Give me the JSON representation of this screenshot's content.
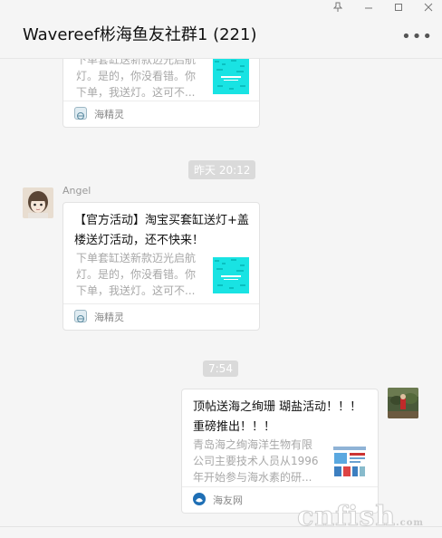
{
  "window": {
    "title": "Wavereef彬海鱼友社群1 (221)",
    "controls": [
      "pin",
      "minimize",
      "maximize",
      "close"
    ],
    "more_label": "•••"
  },
  "messages": [
    {
      "type": "card",
      "partial": true,
      "desc": "下单套缸送新款迈光启航灯。是的，你没看错。你下单，我送灯。这可不...",
      "source": "海精灵"
    },
    {
      "type": "time",
      "text": "昨天 20:12"
    },
    {
      "type": "card",
      "sender": "Angel",
      "title": "【官方活动】淘宝买套缸送灯+盖楼送灯活动，还不快来！",
      "desc": "下单套缸送新款迈光启航灯。是的，你没看错。你下单，我送灯。这可不...",
      "source": "海精灵"
    },
    {
      "type": "time",
      "text": "7:54"
    },
    {
      "type": "card",
      "self": true,
      "title": "顶帖送海之绚珊 瑚盐活动！！！重磅推出！！！",
      "desc": "青岛海之绚海洋生物有限公司主要技术人员从1996年开始参与海水素的研...",
      "source": "海友网"
    }
  ],
  "watermark": "cnfish",
  "watermark_suffix": ".com",
  "colors": {
    "background": "#f5f5f5",
    "card": "#ffffff",
    "time_pill": "#dadada",
    "thumb_cyan": "#19e3e3"
  }
}
